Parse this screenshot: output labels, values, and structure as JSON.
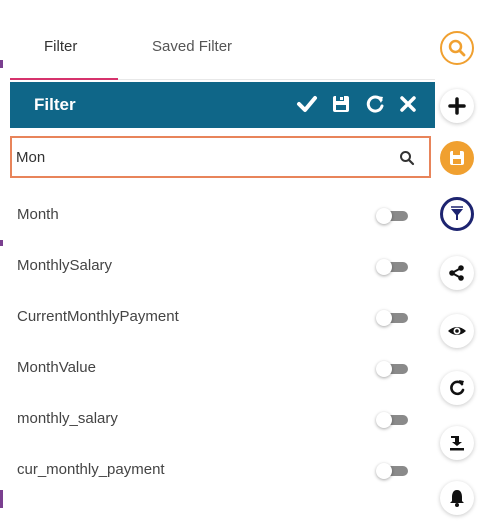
{
  "tabs": [
    {
      "label": "Filter",
      "active": true
    },
    {
      "label": "Saved Filter",
      "active": false
    }
  ],
  "filter_panel": {
    "title": "Filter",
    "header_icons": [
      "check-icon",
      "save-icon",
      "refresh-icon",
      "close-icon"
    ]
  },
  "search": {
    "value": "Mon",
    "placeholder": ""
  },
  "fields": [
    {
      "label": "Month",
      "enabled": false
    },
    {
      "label": "MonthlySalary",
      "enabled": false
    },
    {
      "label": "CurrentMonthlyPayment",
      "enabled": false
    },
    {
      "label": "MonthValue",
      "enabled": false
    },
    {
      "label": "monthly_salary",
      "enabled": false
    },
    {
      "label": "cur_monthly_payment",
      "enabled": false
    }
  ],
  "side_toolbar": [
    "search-icon",
    "plus-icon",
    "save-icon",
    "filter-icon",
    "share-icon",
    "eye-icon",
    "refresh-icon",
    "export-icon",
    "bell-icon"
  ],
  "colors": {
    "header_bg": "#0f6688",
    "search_border": "#e8845a",
    "accent_orange": "#f0a030",
    "filter_ring": "#1d2470",
    "tab_underline": "#d6336c"
  }
}
